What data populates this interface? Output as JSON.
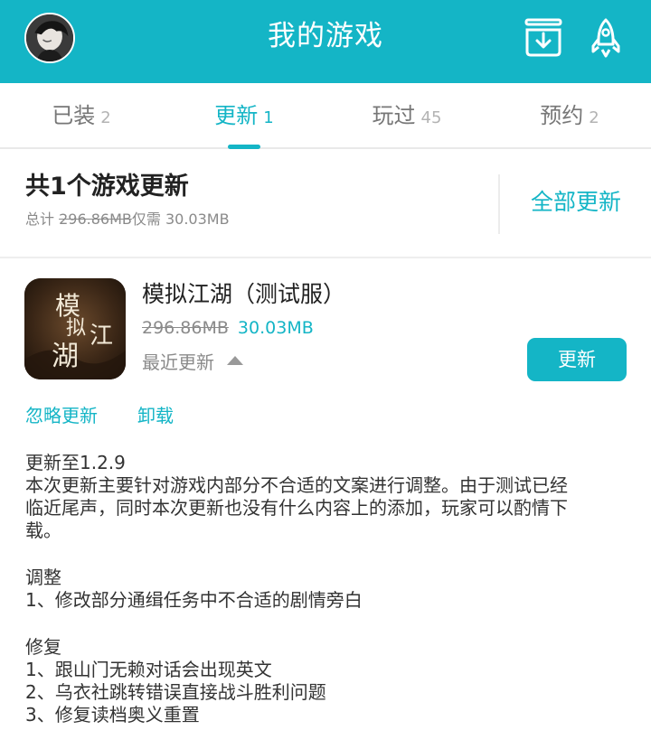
{
  "header": {
    "title": "我的游戏",
    "accent_color": "#14b5c6",
    "avatar_icon": "user-avatar",
    "download_icon": "download-box-icon",
    "rocket_icon": "rocket-icon"
  },
  "tabs": [
    {
      "label": "已装",
      "count": "2",
      "active": false
    },
    {
      "label": "更新",
      "count": "1",
      "active": true
    },
    {
      "label": "玩过",
      "count": "45",
      "active": false
    },
    {
      "label": "预约",
      "count": "2",
      "active": false
    }
  ],
  "summary": {
    "title": "共1个游戏更新",
    "total_prefix": "总计",
    "total_old": "296.86MB",
    "need_prefix": "仅需",
    "need_size": "30.03MB",
    "update_all": "全部更新"
  },
  "game": {
    "name": "模拟江湖（测试服）",
    "old_size": "296.86MB",
    "new_size": "30.03MB",
    "recent_label": "最近更新",
    "update_button": "更新",
    "ignore_label": "忽略更新",
    "uninstall_label": "卸载",
    "icon_text": [
      "模",
      "拟",
      "江",
      "湖"
    ]
  },
  "changelog": {
    "version": "更新至1.2.9",
    "intro_1": "本次更新主要针对游戏内部分不合适的文案进行调整。由于测试已经",
    "intro_2": "临近尾声，同时本次更新也没有什么内容上的添加，玩家可以酌情下",
    "intro_3": "载。",
    "adjust_title": "调整",
    "adjust_1": "1、修改部分通缉任务中不合适的剧情旁白",
    "fix_title": "修复",
    "fix_1": "1、跟山门无赖对话会出现英文",
    "fix_2": "2、乌衣社跳转错误直接战斗胜利问题",
    "fix_3": "3、修复读档奥义重置"
  }
}
